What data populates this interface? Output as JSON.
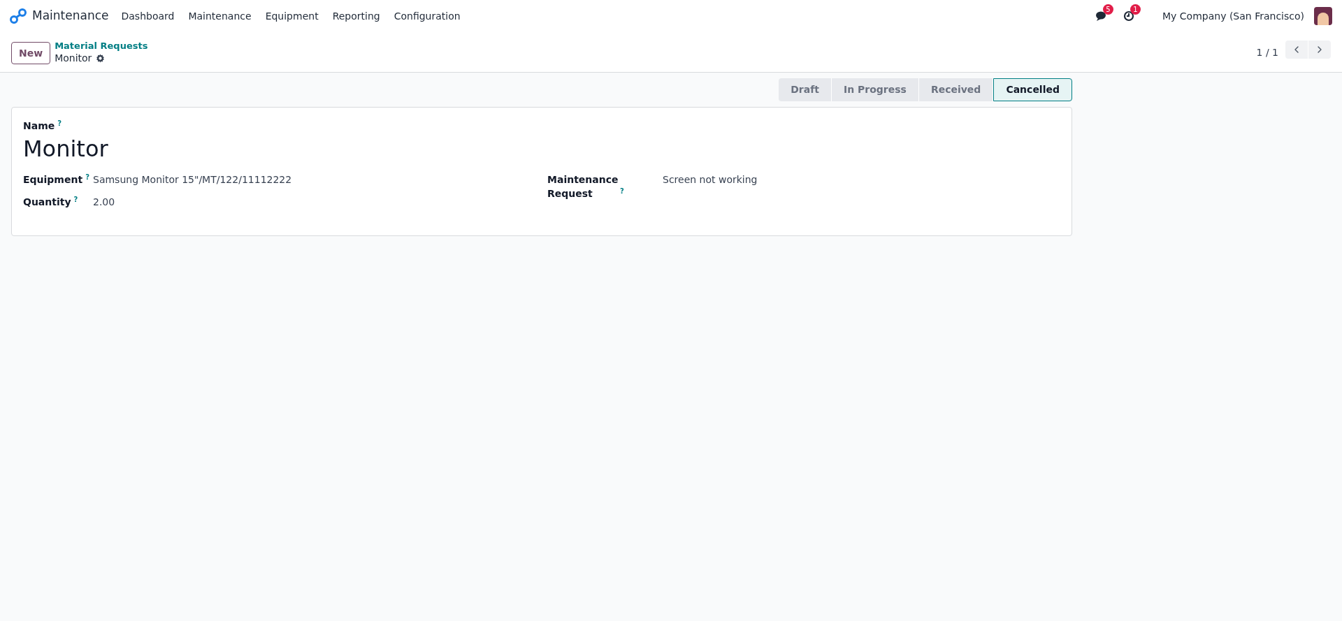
{
  "navbar": {
    "app_name": "Maintenance",
    "menu": [
      "Dashboard",
      "Maintenance",
      "Equipment",
      "Reporting",
      "Configuration"
    ],
    "messages_count": "5",
    "activities_count": "1",
    "company": "My Company (San Francisco)"
  },
  "control_panel": {
    "new_button": "New",
    "breadcrumb": "Material Requests",
    "record": "Monitor",
    "pager": "1 / 1"
  },
  "status_stages": [
    {
      "label": "Draft",
      "selected": false
    },
    {
      "label": "In Progress",
      "selected": false
    },
    {
      "label": "Received",
      "selected": false
    },
    {
      "label": "Cancelled",
      "selected": true
    }
  ],
  "form": {
    "name_label": "Name",
    "name_help": "?",
    "name": "Monitor",
    "left_fields": [
      {
        "label": "Equipment",
        "help": "?",
        "value": "Samsung Monitor 15\"/MT/122/11112222"
      },
      {
        "label": "Quantity",
        "help": "?",
        "value": "2.00"
      }
    ],
    "right_fields": [
      {
        "label": "Maintenance Request",
        "help": "?",
        "value": "Screen not working"
      }
    ]
  }
}
